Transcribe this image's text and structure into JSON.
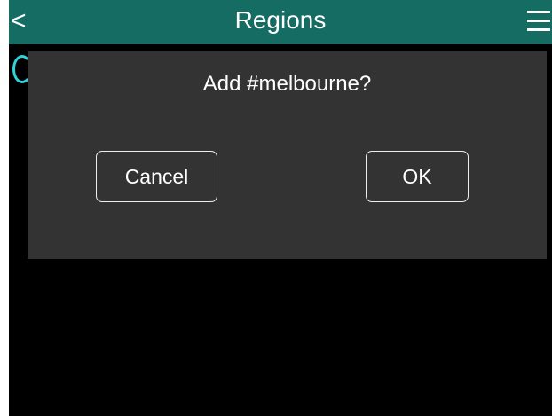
{
  "header": {
    "back_label": "<",
    "title": "Regions",
    "menu_icon": "hamburger-menu-icon"
  },
  "dialog": {
    "message": "Add #melbourne?",
    "cancel_label": "Cancel",
    "ok_label": "OK"
  },
  "colors": {
    "header_bg": "#156c63",
    "screen_bg": "#000000",
    "dialog_bg": "#333333",
    "accent": "#2fd3d8",
    "text": "#ffffff"
  }
}
